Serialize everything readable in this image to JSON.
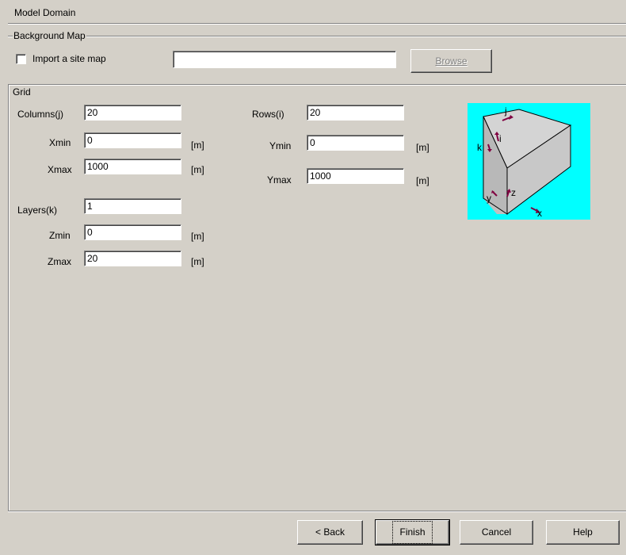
{
  "window": {
    "title": "Model Domain"
  },
  "background_map": {
    "group_label": "Background Map",
    "import_label": "Import a site map",
    "import_checked": false,
    "path_value": "",
    "browse_label": "Browse"
  },
  "grid": {
    "group_label": "Grid",
    "columns": {
      "label": "Columns(j)",
      "value": "20"
    },
    "xmin": {
      "label": "Xmin",
      "value": "0",
      "unit": "[m]"
    },
    "xmax": {
      "label": "Xmax",
      "value": "1000",
      "unit": "[m]"
    },
    "rows": {
      "label": "Rows(i)",
      "value": "20"
    },
    "ymin": {
      "label": "Ymin",
      "value": "0",
      "unit": "[m]"
    },
    "ymax": {
      "label": "Ymax",
      "value": "1000",
      "unit": "[m]"
    },
    "layers": {
      "label": "Layers(k)",
      "value": "1"
    },
    "zmin": {
      "label": "Zmin",
      "value": "0",
      "unit": "[m]"
    },
    "zmax": {
      "label": "Zmax",
      "value": "20",
      "unit": "[m]"
    },
    "diagram": {
      "background_color": "#00ffff",
      "axis_color": "#800040",
      "labels": {
        "j": "j",
        "i": "i",
        "k": "k",
        "y": "y",
        "z": "z",
        "x": "x"
      }
    }
  },
  "footer": {
    "back_label": "< Back",
    "finish_label": "Finish",
    "cancel_label": "Cancel",
    "help_label": "Help"
  }
}
